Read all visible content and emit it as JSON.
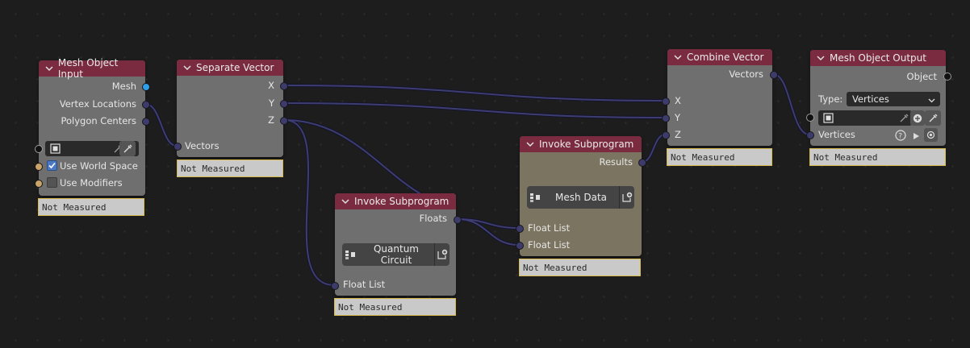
{
  "nodes": {
    "mesh_object_input": {
      "title": "Mesh Object Input",
      "outputs": [
        "Mesh",
        "Vertex Locations",
        "Polygon Centers"
      ],
      "use_world_space": {
        "label": "Use World Space",
        "checked": true
      },
      "use_modifiers": {
        "label": "Use Modifiers",
        "checked": false
      },
      "status": "Not Measured"
    },
    "separate_vector": {
      "title": "Separate Vector",
      "outputs": [
        "X",
        "Y",
        "Z"
      ],
      "input": "Vectors",
      "status": "Not Measured"
    },
    "invoke_subprogram_1": {
      "title": "Invoke Subprogram",
      "output": "Floats",
      "subprogram": "Quantum Circuit",
      "input": "Float List",
      "status": "Not Measured"
    },
    "invoke_subprogram_2": {
      "title": "Invoke Subprogram",
      "output": "Results",
      "subprogram": "Mesh Data",
      "inputs": [
        "Float List",
        "Float List"
      ],
      "status": "Not Measured"
    },
    "combine_vector": {
      "title": "Combine Vector",
      "output": "Vectors",
      "inputs": [
        "X",
        "Y",
        "Z"
      ],
      "status": "Not Measured"
    },
    "mesh_object_output": {
      "title": "Mesh Object Output",
      "output": "Object",
      "type_label": "Type:",
      "type_value": "Vertices",
      "input": "Vertices",
      "status": "Not Measured"
    }
  },
  "colors": {
    "header": "#7a2b40",
    "node_body": "#6f6f6f",
    "frame_body": "#7a7460",
    "link": "#3c3b6b",
    "status_border": "#d7b94c"
  }
}
